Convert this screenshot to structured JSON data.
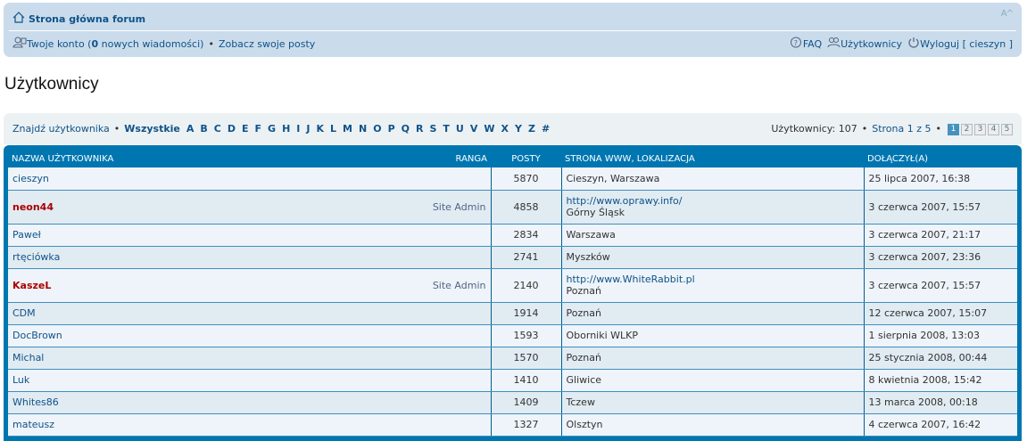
{
  "header": {
    "home_label": "Strona główna forum",
    "resize": "A^",
    "account_prefix": "Twoje konto (",
    "new_count": "0",
    "account_suffix": " nowych wiadomości)",
    "view_posts": "Zobacz swoje posty",
    "faq": "FAQ",
    "members": "Użytkownicy",
    "logout": "Wyloguj [ cieszyn ]"
  },
  "page_title": "Użytkownicy",
  "filter": {
    "find_label": "Znajdź użytkownika",
    "all_label": "Wszystkie",
    "letters": [
      "A",
      "B",
      "C",
      "D",
      "E",
      "F",
      "G",
      "H",
      "I",
      "J",
      "K",
      "L",
      "M",
      "N",
      "O",
      "P",
      "Q",
      "R",
      "S",
      "T",
      "U",
      "V",
      "W",
      "X",
      "Y",
      "Z",
      "#"
    ],
    "users_count": "Użytkownicy: 107",
    "page_info": "Strona 1 z 5",
    "pages": [
      "1",
      "2",
      "3",
      "4",
      "5"
    ],
    "active_page": "1"
  },
  "table": {
    "headers": {
      "username": "NAZWA UŻYTKOWNIKA",
      "rank": "RANGA",
      "posts": "POSTY",
      "www": "STRONA WWW, LOKALIZACJA",
      "joined": "DOŁĄCZYŁ(A)"
    },
    "rows": [
      {
        "name": "cieszyn",
        "admin": false,
        "rank": "",
        "posts": "5870",
        "www": "",
        "loc": "Cieszyn, Warszawa",
        "joined": "25 lipca 2007, 16:38"
      },
      {
        "name": "neon44",
        "admin": true,
        "rank": "Site Admin",
        "posts": "4858",
        "www": "http://www.oprawy.info/",
        "loc": "Górny Śląsk",
        "joined": "3 czerwca 2007, 15:57"
      },
      {
        "name": "Paweł",
        "admin": false,
        "rank": "",
        "posts": "2834",
        "www": "",
        "loc": "Warszawa",
        "joined": "3 czerwca 2007, 21:17"
      },
      {
        "name": "rtęciówka",
        "admin": false,
        "rank": "",
        "posts": "2741",
        "www": "",
        "loc": "Myszków",
        "joined": "3 czerwca 2007, 23:36"
      },
      {
        "name": "KaszeL",
        "admin": true,
        "rank": "Site Admin",
        "posts": "2140",
        "www": "http://www.WhiteRabbit.pl",
        "loc": "Poznań",
        "joined": "3 czerwca 2007, 15:57"
      },
      {
        "name": "CDM",
        "admin": false,
        "rank": "",
        "posts": "1914",
        "www": "",
        "loc": "Poznań",
        "joined": "12 czerwca 2007, 15:07"
      },
      {
        "name": "DocBrown",
        "admin": false,
        "rank": "",
        "posts": "1593",
        "www": "",
        "loc": "Oborniki WLKP",
        "joined": "1 sierpnia 2008, 13:03"
      },
      {
        "name": "Michal",
        "admin": false,
        "rank": "",
        "posts": "1570",
        "www": "",
        "loc": "Poznań",
        "joined": "25 stycznia 2008, 00:44"
      },
      {
        "name": "Luk",
        "admin": false,
        "rank": "",
        "posts": "1410",
        "www": "",
        "loc": "Gliwice",
        "joined": "8 kwietnia 2008, 15:42"
      },
      {
        "name": "Whites86",
        "admin": false,
        "rank": "",
        "posts": "1409",
        "www": "",
        "loc": "Tczew",
        "joined": "13 marca 2008, 00:18"
      },
      {
        "name": "mateusz",
        "admin": false,
        "rank": "",
        "posts": "1327",
        "www": "",
        "loc": "Olsztyn",
        "joined": "4 czerwca 2007, 16:42"
      }
    ]
  },
  "colors": {
    "header_bg": "#cadceb",
    "link": "#105289",
    "admin": "#aa0000",
    "table_header": "#0076b1"
  }
}
